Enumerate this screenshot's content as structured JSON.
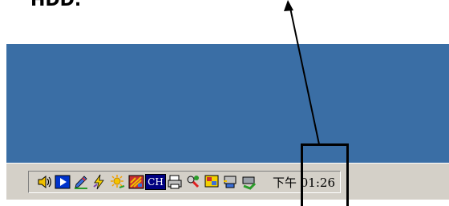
{
  "annotation": {
    "caption": "HDD."
  },
  "taskbar": {
    "clock": "下午 01:26",
    "ime_label": "CH",
    "tray_icons": [
      {
        "name": "speaker-icon"
      },
      {
        "name": "media-player-icon"
      },
      {
        "name": "pen-tool-icon"
      },
      {
        "name": "lightning-icon"
      },
      {
        "name": "sun-icon"
      },
      {
        "name": "red-pattern-icon"
      },
      {
        "name": "ime-ch-icon"
      },
      {
        "name": "printer-icon"
      },
      {
        "name": "network-scan-icon"
      },
      {
        "name": "display-settings-icon"
      },
      {
        "name": "hardware-icon"
      },
      {
        "name": "safely-remove-hardware-icon"
      }
    ]
  },
  "colors": {
    "desktop": "#3a6ea5",
    "taskbar": "#d4d0c8",
    "annotation": "#000000"
  }
}
